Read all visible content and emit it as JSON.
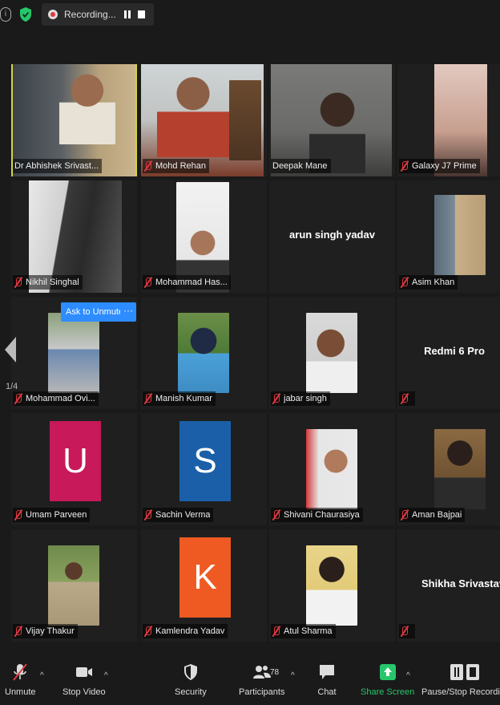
{
  "topbar": {
    "info_icon": "info-icon",
    "shield_icon": "shield-check-icon",
    "recording_label": "Recording..."
  },
  "colors": {
    "active_speaker": "#d6d24a",
    "muted_red": "#e0393e",
    "share_green": "#26c66b",
    "ask_blue": "#2d8cff"
  },
  "grid": {
    "participants": [
      {
        "name": "Dr Abhishek Srivast...",
        "muted": false,
        "kind": "video"
      },
      {
        "name": "Mohd Rehan",
        "muted": true,
        "kind": "video"
      },
      {
        "name": "Deepak Mane",
        "muted": false,
        "kind": "video"
      },
      {
        "name": "Galaxy J7 Prime",
        "muted": true,
        "kind": "video"
      },
      {
        "name": "Nikhil Singhal",
        "muted": true,
        "kind": "video"
      },
      {
        "name": "Mohammad Has...",
        "muted": true,
        "kind": "photo"
      },
      {
        "name": "arun singh yadav",
        "muted": false,
        "kind": "name"
      },
      {
        "name": "Asim Khan",
        "muted": true,
        "kind": "photo"
      },
      {
        "name": "Mohammad Ovi...",
        "muted": true,
        "kind": "photo"
      },
      {
        "name": "Manish Kumar",
        "muted": true,
        "kind": "photo"
      },
      {
        "name": "jabar singh",
        "muted": true,
        "kind": "photo"
      },
      {
        "name": "Redmi 6 Pro",
        "muted": true,
        "kind": "name"
      },
      {
        "name": "Umam Parveen",
        "muted": true,
        "kind": "avatar",
        "letter": "U",
        "avatar_color": "#c8195a"
      },
      {
        "name": "Sachin Verma",
        "muted": true,
        "kind": "avatar",
        "letter": "S",
        "avatar_color": "#1b5fa8"
      },
      {
        "name": "Shivani Chaurasiya",
        "muted": true,
        "kind": "photo"
      },
      {
        "name": "Aman Bajpai",
        "muted": true,
        "kind": "photo"
      },
      {
        "name": "Vijay Thakur",
        "muted": true,
        "kind": "photo"
      },
      {
        "name": "Kamlendra Yadav",
        "muted": true,
        "kind": "avatar",
        "letter": "K",
        "avatar_color": "#ef5a23"
      },
      {
        "name": "Atul Sharma",
        "muted": true,
        "kind": "photo"
      },
      {
        "name": "Shikha Srivastava",
        "muted": true,
        "kind": "name"
      }
    ],
    "ask_to_unmute_label": "Ask to Unmute",
    "more_label": "···",
    "page_indicator": "1/4"
  },
  "toolbar": {
    "unmute_label": "Unmute",
    "stop_video_label": "Stop Video",
    "security_label": "Security",
    "participants_label": "Participants",
    "participants_count": "78",
    "chat_label": "Chat",
    "share_screen_label": "Share Screen",
    "pause_stop_label": "Pause/Stop Recording"
  }
}
